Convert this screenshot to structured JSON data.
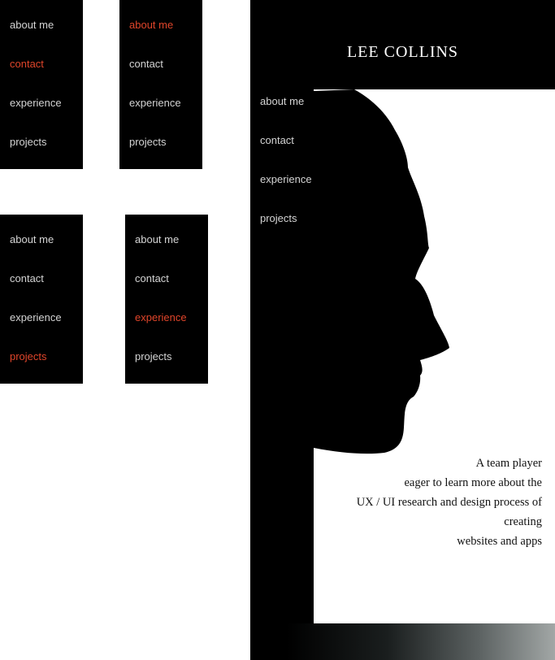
{
  "menus": [
    {
      "items": [
        "about me",
        "contact",
        "experience",
        "projects"
      ],
      "active_index": 1
    },
    {
      "items": [
        "about me",
        "contact",
        "experience",
        "projects"
      ],
      "active_index": 0
    },
    {
      "items": [
        "about me",
        "contact",
        "experience",
        "projects"
      ],
      "active_index": 3
    },
    {
      "items": [
        "about me",
        "contact",
        "experience",
        "projects"
      ],
      "active_index": 2
    }
  ],
  "page": {
    "title": "LEE  COLLINS",
    "nav": [
      "about me",
      "contact",
      "experience",
      "projects"
    ],
    "tagline": [
      "A team player",
      "eager to learn more about the",
      "UX / UI research and design process of",
      "creating",
      "websites and apps"
    ]
  },
  "colors": {
    "active": "#e0452a",
    "inactive": "#d4d4d4",
    "background": "#000000"
  }
}
